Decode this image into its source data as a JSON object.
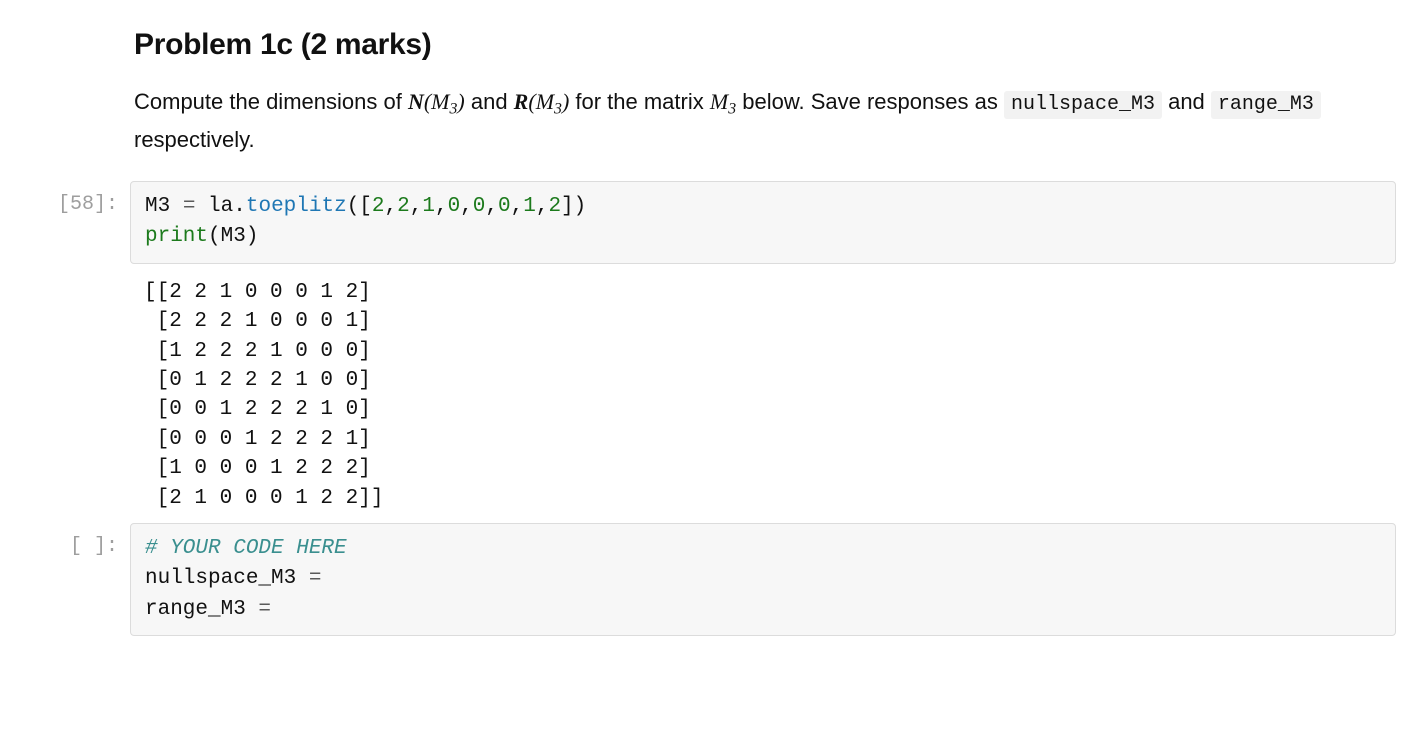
{
  "markdown": {
    "title": "Problem 1c (2 marks)",
    "text_before_math1": "Compute the dimensions of ",
    "math1_fn": "N",
    "math1_var": "M",
    "math1_sub": "3",
    "text_between_math": " and ",
    "math2_fn": "R",
    "math2_var": "M",
    "math2_sub": "3",
    "text_after_math2_before_var": " for the matrix ",
    "math3_var": "M",
    "math3_sub": "3",
    "text_after_var": " below. Save responses as ",
    "code1": "nullspace_M3",
    "text_and": " and ",
    "code2": "range_M3",
    "text_end": " respectively."
  },
  "cell1": {
    "prompt": "[58]:",
    "code": {
      "lhs": "M3",
      "eq": " = ",
      "mod": "la",
      "dot": ".",
      "func": "toeplitz",
      "open": "([",
      "nums": [
        "2",
        "2",
        "1",
        "0",
        "0",
        "0",
        "1",
        "2"
      ],
      "close": "])",
      "line2_print": "print",
      "line2_open": "(",
      "line2_arg": "M3",
      "line2_close": ")"
    },
    "output_lines": [
      "[[2 2 1 0 0 0 1 2]",
      " [2 2 2 1 0 0 0 1]",
      " [1 2 2 2 1 0 0 0]",
      " [0 1 2 2 2 1 0 0]",
      " [0 0 1 2 2 2 1 0]",
      " [0 0 0 1 2 2 2 1]",
      " [1 0 0 0 1 2 2 2]",
      " [2 1 0 0 0 1 2 2]]"
    ]
  },
  "cell2": {
    "prompt": "[ ]:",
    "comment": "# YOUR CODE HERE",
    "line2_lhs": "nullspace_M3",
    "line2_eq": " = ",
    "line3_lhs": "range_M3",
    "line3_eq": " = "
  }
}
